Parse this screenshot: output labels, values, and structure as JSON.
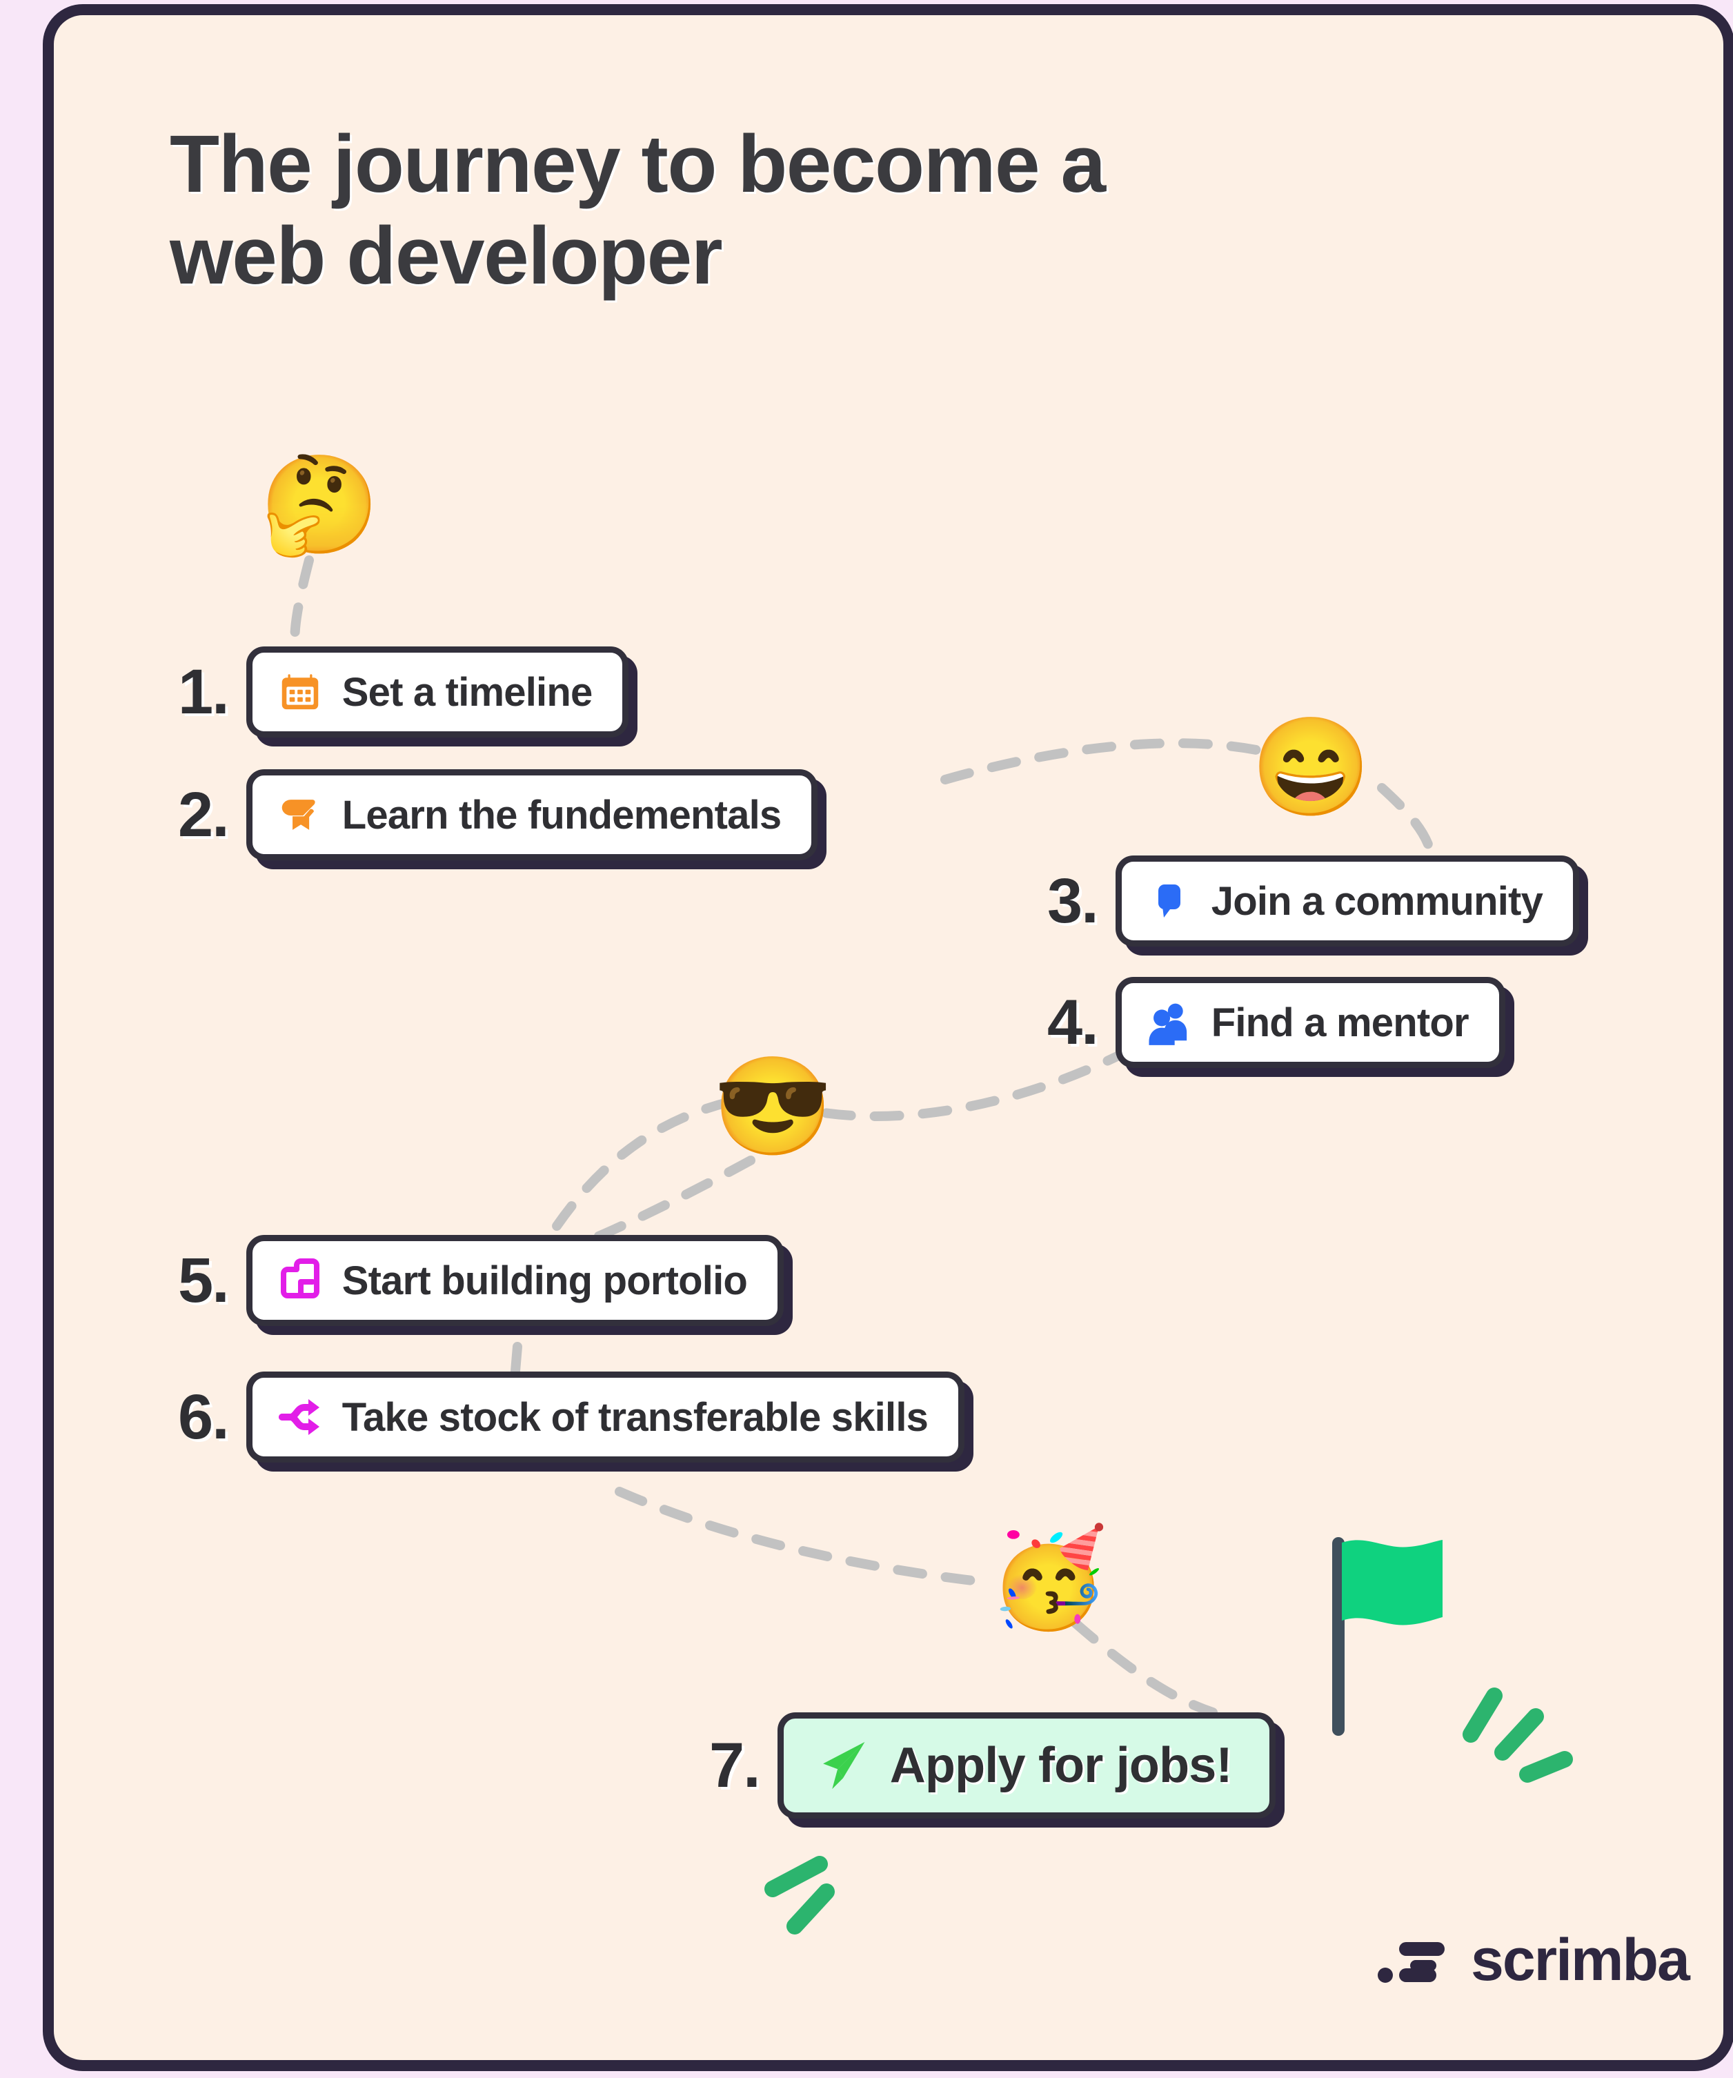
{
  "page": {
    "title_line_1": "The journey to become a",
    "title_line_2": "web developer",
    "background_color": "#fdf0e5",
    "outer_background_color": "#f8e7f8",
    "border_color": "#2e2740"
  },
  "steps": [
    {
      "number": "1.",
      "label": "Set a timeline",
      "icon": "calendar-icon",
      "icon_color": "#f79226",
      "card_background": "#ffffff"
    },
    {
      "number": "2.",
      "label": "Learn the fundementals",
      "icon": "bookmark-learn-icon",
      "icon_color": "#f79226",
      "card_background": "#ffffff"
    },
    {
      "number": "3.",
      "label": "Join a community",
      "icon": "speech-bubble-icon",
      "icon_color": "#2b6cf6",
      "card_background": "#ffffff"
    },
    {
      "number": "4.",
      "label": "Find a mentor",
      "icon": "two-people-icon",
      "icon_color": "#2b6cf6",
      "card_background": "#ffffff"
    },
    {
      "number": "5.",
      "label": "Start building portolio",
      "icon": "portfolio-layout-icon",
      "icon_color": "#e21ee8",
      "card_background": "#ffffff"
    },
    {
      "number": "6.",
      "label": "Take stock of transferable skills",
      "icon": "branch-split-icon",
      "icon_color": "#e21ee8",
      "card_background": "#ffffff"
    },
    {
      "number": "7.",
      "label": "Apply for jobs!",
      "icon": "paper-plane-icon",
      "icon_color": "#3bd14d",
      "card_background": "#d6fae7"
    }
  ],
  "emojis": [
    {
      "name": "thinking-face-emoji",
      "glyph": "🤔"
    },
    {
      "name": "grinning-face-emoji",
      "glyph": "😄"
    },
    {
      "name": "cool-sunglasses-emoji",
      "glyph": "😎"
    },
    {
      "name": "partying-face-emoji",
      "glyph": "🥳"
    }
  ],
  "decor": {
    "flag_icon": "green-goal-flag-icon",
    "flag_color": "#0fd27f",
    "flag_pole_color": "#3f4f5c",
    "sparkle_color": "#2cb46e",
    "path_color": "#c2c2c2"
  },
  "footer": {
    "brand": "scrimba",
    "logo_icon": "scrimba-speed-lines-icon",
    "brand_color": "#2e2740"
  }
}
